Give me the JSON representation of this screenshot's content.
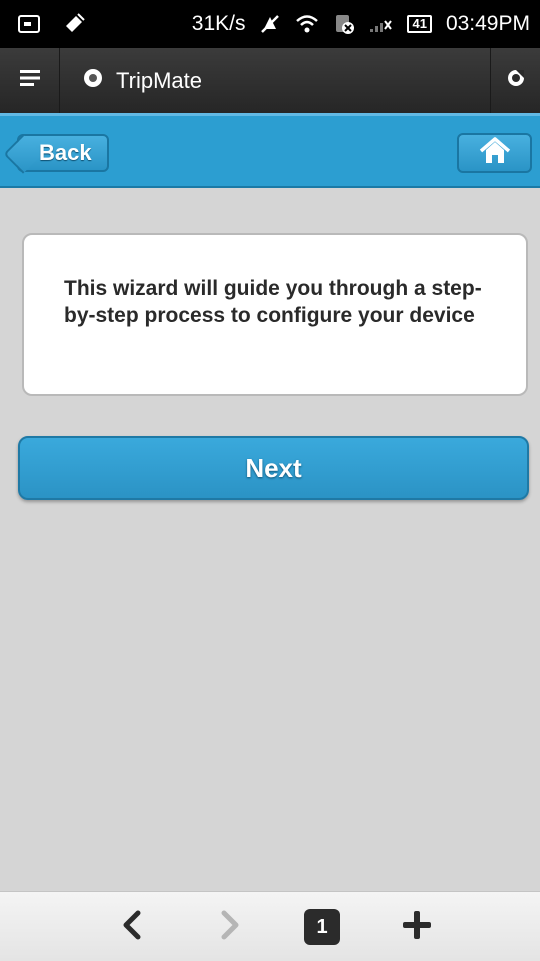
{
  "status_bar": {
    "speed": "31K/s",
    "battery": "41",
    "time": "03:49PM"
  },
  "browser": {
    "title": "TripMate"
  },
  "header": {
    "back_label": "Back"
  },
  "main": {
    "intro_text": "This wizard will guide you through a step-by-step process to configure your device",
    "next_label": "Next"
  },
  "bottom_bar": {
    "tab_count": "1"
  },
  "colors": {
    "accent": "#2c9ed1",
    "background": "#d5d5d5"
  }
}
